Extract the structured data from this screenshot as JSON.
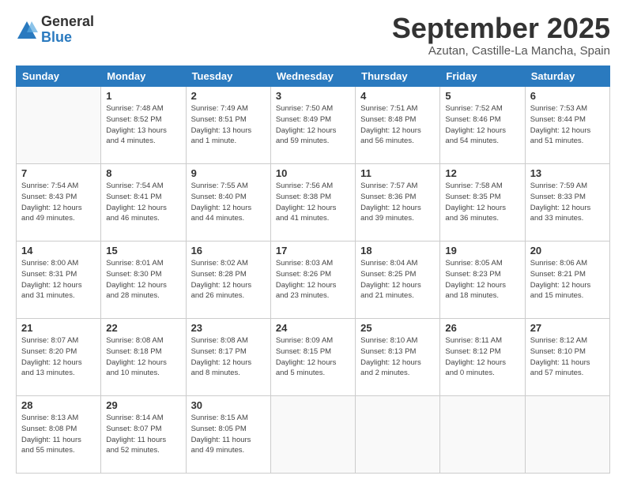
{
  "logo": {
    "general": "General",
    "blue": "Blue"
  },
  "title": "September 2025",
  "subtitle": "Azutan, Castille-La Mancha, Spain",
  "weekdays": [
    "Sunday",
    "Monday",
    "Tuesday",
    "Wednesday",
    "Thursday",
    "Friday",
    "Saturday"
  ],
  "weeks": [
    [
      {
        "day": "",
        "info": ""
      },
      {
        "day": "1",
        "info": "Sunrise: 7:48 AM\nSunset: 8:52 PM\nDaylight: 13 hours\nand 4 minutes."
      },
      {
        "day": "2",
        "info": "Sunrise: 7:49 AM\nSunset: 8:51 PM\nDaylight: 13 hours\nand 1 minute."
      },
      {
        "day": "3",
        "info": "Sunrise: 7:50 AM\nSunset: 8:49 PM\nDaylight: 12 hours\nand 59 minutes."
      },
      {
        "day": "4",
        "info": "Sunrise: 7:51 AM\nSunset: 8:48 PM\nDaylight: 12 hours\nand 56 minutes."
      },
      {
        "day": "5",
        "info": "Sunrise: 7:52 AM\nSunset: 8:46 PM\nDaylight: 12 hours\nand 54 minutes."
      },
      {
        "day": "6",
        "info": "Sunrise: 7:53 AM\nSunset: 8:44 PM\nDaylight: 12 hours\nand 51 minutes."
      }
    ],
    [
      {
        "day": "7",
        "info": "Sunrise: 7:54 AM\nSunset: 8:43 PM\nDaylight: 12 hours\nand 49 minutes."
      },
      {
        "day": "8",
        "info": "Sunrise: 7:54 AM\nSunset: 8:41 PM\nDaylight: 12 hours\nand 46 minutes."
      },
      {
        "day": "9",
        "info": "Sunrise: 7:55 AM\nSunset: 8:40 PM\nDaylight: 12 hours\nand 44 minutes."
      },
      {
        "day": "10",
        "info": "Sunrise: 7:56 AM\nSunset: 8:38 PM\nDaylight: 12 hours\nand 41 minutes."
      },
      {
        "day": "11",
        "info": "Sunrise: 7:57 AM\nSunset: 8:36 PM\nDaylight: 12 hours\nand 39 minutes."
      },
      {
        "day": "12",
        "info": "Sunrise: 7:58 AM\nSunset: 8:35 PM\nDaylight: 12 hours\nand 36 minutes."
      },
      {
        "day": "13",
        "info": "Sunrise: 7:59 AM\nSunset: 8:33 PM\nDaylight: 12 hours\nand 33 minutes."
      }
    ],
    [
      {
        "day": "14",
        "info": "Sunrise: 8:00 AM\nSunset: 8:31 PM\nDaylight: 12 hours\nand 31 minutes."
      },
      {
        "day": "15",
        "info": "Sunrise: 8:01 AM\nSunset: 8:30 PM\nDaylight: 12 hours\nand 28 minutes."
      },
      {
        "day": "16",
        "info": "Sunrise: 8:02 AM\nSunset: 8:28 PM\nDaylight: 12 hours\nand 26 minutes."
      },
      {
        "day": "17",
        "info": "Sunrise: 8:03 AM\nSunset: 8:26 PM\nDaylight: 12 hours\nand 23 minutes."
      },
      {
        "day": "18",
        "info": "Sunrise: 8:04 AM\nSunset: 8:25 PM\nDaylight: 12 hours\nand 21 minutes."
      },
      {
        "day": "19",
        "info": "Sunrise: 8:05 AM\nSunset: 8:23 PM\nDaylight: 12 hours\nand 18 minutes."
      },
      {
        "day": "20",
        "info": "Sunrise: 8:06 AM\nSunset: 8:21 PM\nDaylight: 12 hours\nand 15 minutes."
      }
    ],
    [
      {
        "day": "21",
        "info": "Sunrise: 8:07 AM\nSunset: 8:20 PM\nDaylight: 12 hours\nand 13 minutes."
      },
      {
        "day": "22",
        "info": "Sunrise: 8:08 AM\nSunset: 8:18 PM\nDaylight: 12 hours\nand 10 minutes."
      },
      {
        "day": "23",
        "info": "Sunrise: 8:08 AM\nSunset: 8:17 PM\nDaylight: 12 hours\nand 8 minutes."
      },
      {
        "day": "24",
        "info": "Sunrise: 8:09 AM\nSunset: 8:15 PM\nDaylight: 12 hours\nand 5 minutes."
      },
      {
        "day": "25",
        "info": "Sunrise: 8:10 AM\nSunset: 8:13 PM\nDaylight: 12 hours\nand 2 minutes."
      },
      {
        "day": "26",
        "info": "Sunrise: 8:11 AM\nSunset: 8:12 PM\nDaylight: 12 hours\nand 0 minutes."
      },
      {
        "day": "27",
        "info": "Sunrise: 8:12 AM\nSunset: 8:10 PM\nDaylight: 11 hours\nand 57 minutes."
      }
    ],
    [
      {
        "day": "28",
        "info": "Sunrise: 8:13 AM\nSunset: 8:08 PM\nDaylight: 11 hours\nand 55 minutes."
      },
      {
        "day": "29",
        "info": "Sunrise: 8:14 AM\nSunset: 8:07 PM\nDaylight: 11 hours\nand 52 minutes."
      },
      {
        "day": "30",
        "info": "Sunrise: 8:15 AM\nSunset: 8:05 PM\nDaylight: 11 hours\nand 49 minutes."
      },
      {
        "day": "",
        "info": ""
      },
      {
        "day": "",
        "info": ""
      },
      {
        "day": "",
        "info": ""
      },
      {
        "day": "",
        "info": ""
      }
    ]
  ]
}
